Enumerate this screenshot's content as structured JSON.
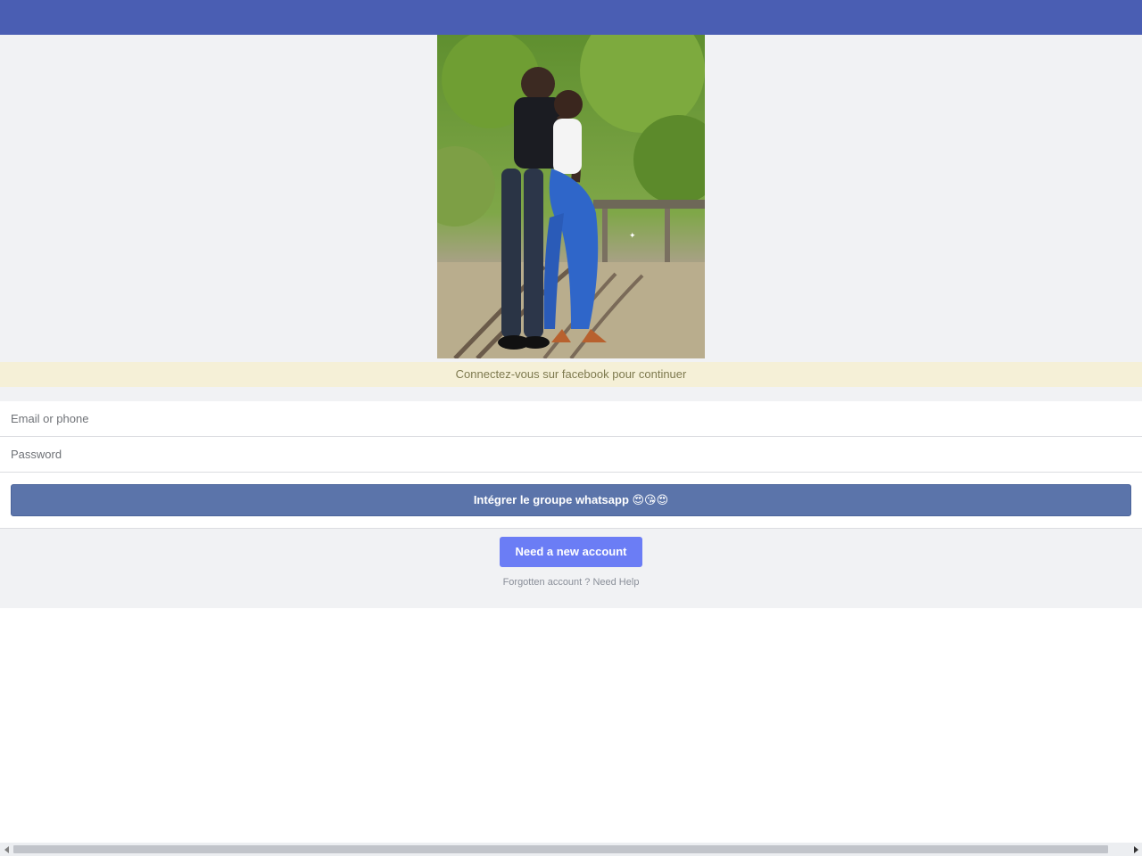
{
  "header": {
    "bar_color": "#4a5eb3"
  },
  "hero": {
    "image_alt": "Couple photo"
  },
  "notice": {
    "text": "Connectez-vous sur facebook pour continuer"
  },
  "login": {
    "email_placeholder": "Email or phone",
    "password_placeholder": "Password",
    "join_button": "Intégrer le groupe whatsapp 😍😘😍"
  },
  "signup": {
    "new_account_button": "Need a new account"
  },
  "help": {
    "text": "Forgotten account ? Need Help"
  },
  "colors": {
    "accent": "#6b7df5",
    "join_button": "#5b74aa",
    "notice_bg": "#f5f0d7",
    "page_bg": "#f1f2f4"
  },
  "icons": {
    "scroll_left": "chevron-left-icon",
    "scroll_right": "chevron-right-icon"
  }
}
